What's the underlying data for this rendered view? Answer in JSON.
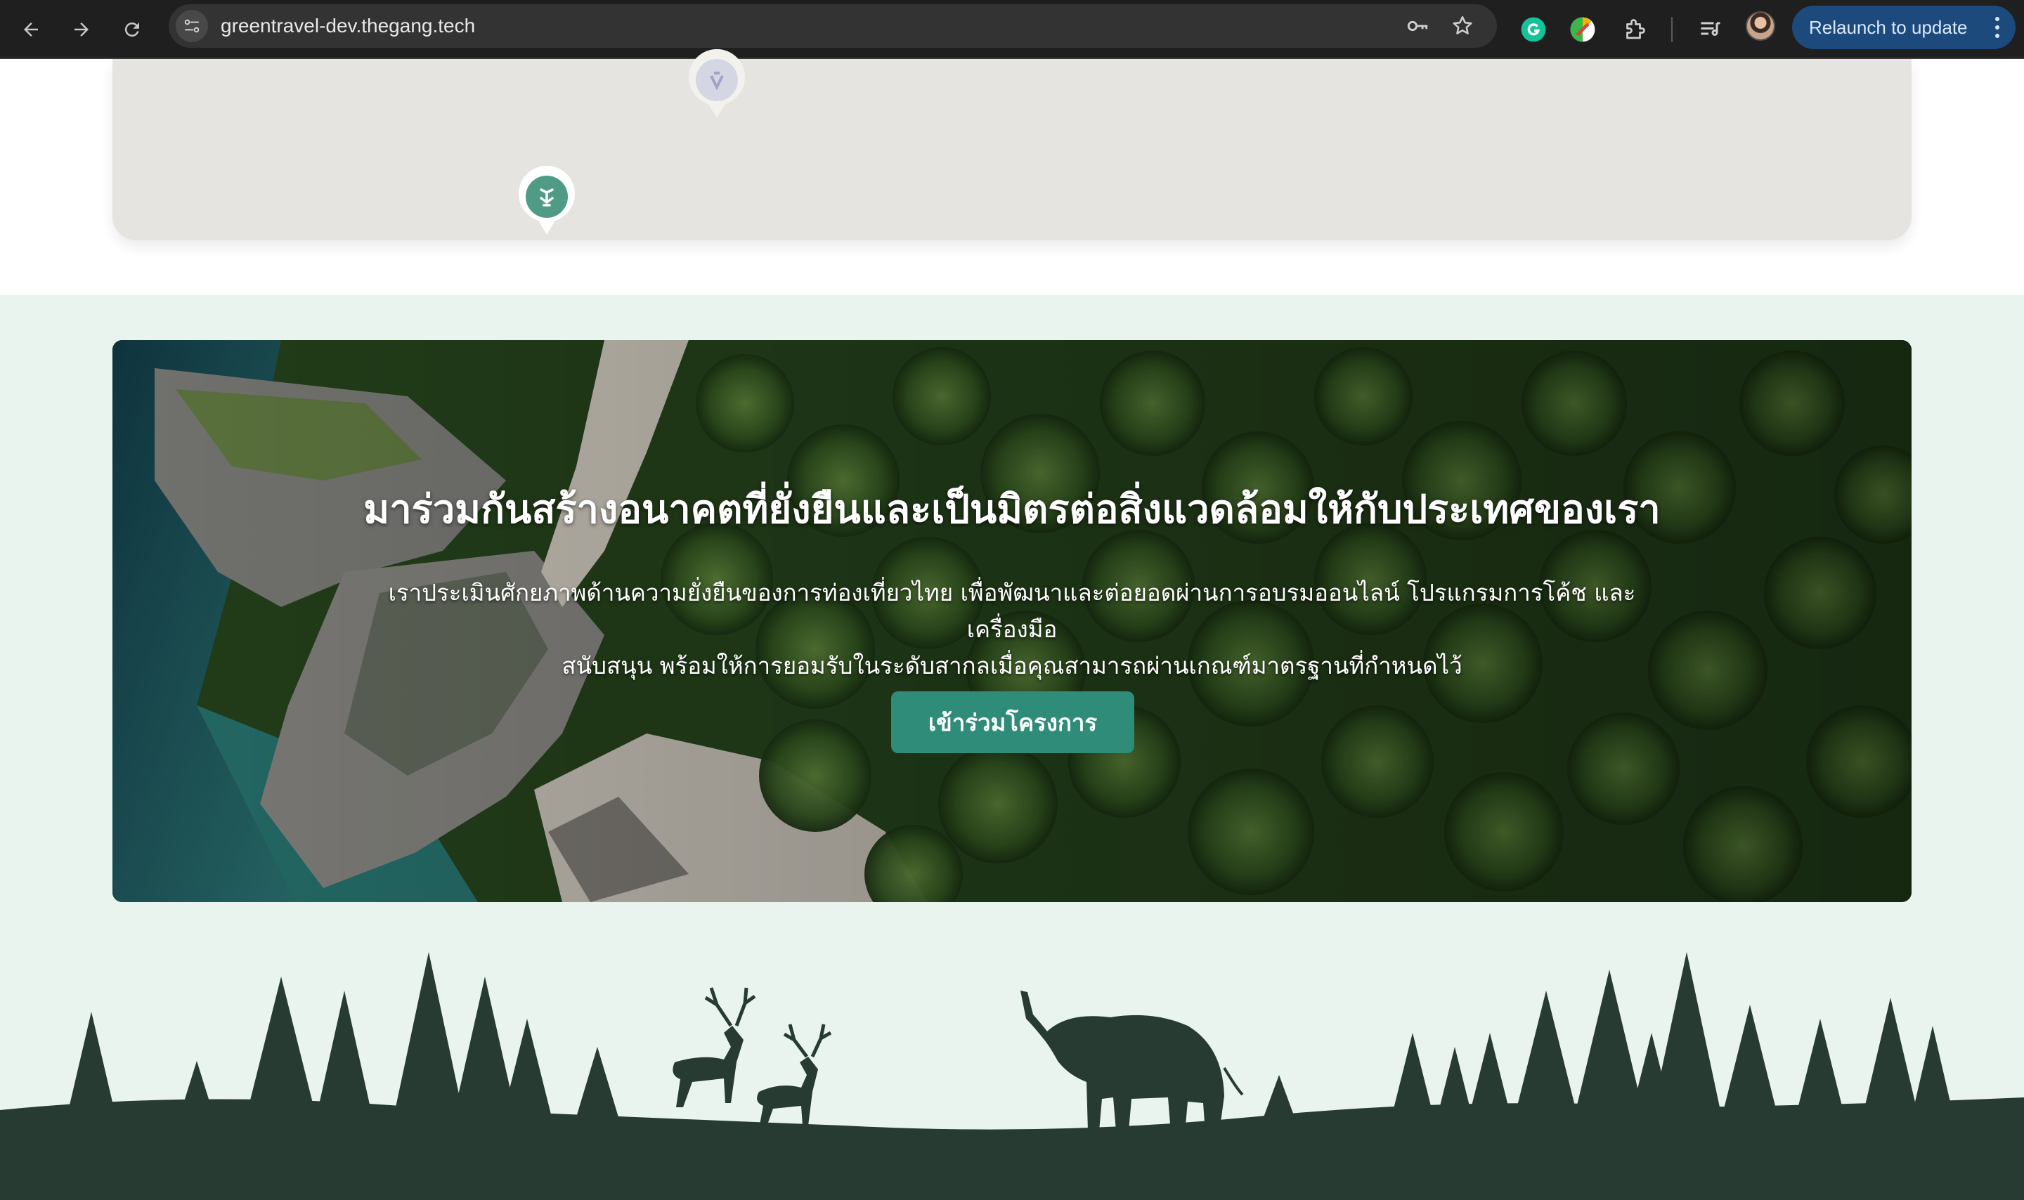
{
  "browser": {
    "url": "greentravel-dev.thegang.tech",
    "relaunch_label": "Relaunch to update",
    "icons": [
      "back-icon",
      "forward-icon",
      "reload-icon",
      "site-info-icon",
      "password-key-icon",
      "bookmark-star-icon",
      "grammarly-icon",
      "color-picker-extension-icon",
      "extensions-puzzle-icon",
      "reading-list-icon",
      "profile-avatar",
      "menu-dots-icon"
    ],
    "accent_color": "#1c4a7c"
  },
  "map": {
    "markers": [
      "tourism-marker-muted",
      "tourism-marker-active"
    ],
    "marker_color": "#4f9b86"
  },
  "cta": {
    "title": "มาร่วมกันสร้างอนาคตที่ยั่งยืนและเป็นมิตรต่อสิ่งแวดล้อมให้กับประเทศของเรา",
    "description_line1": "เราประเมินศักยภาพด้านความยั่งยืนของการท่องเที่ยวไทย เพื่อพัฒนาและต่อยอดผ่านการอบรมออนไลน์ โปรแกรมการโค้ช และเครื่องมือ",
    "description_line2": "สนับสนุน พร้อมให้การยอมรับในระดับสากลเมื่อคุณสามารถผ่านเกณฑ์มาตรฐานที่กำหนดไว้",
    "button_label": "เข้าร่วมโครงการ",
    "button_color": "#2f8c79",
    "band_color": "#e9f4ef"
  },
  "footer": {
    "silhouette_color": "#273b33",
    "animals": [
      "deer",
      "deer",
      "elephant"
    ]
  }
}
